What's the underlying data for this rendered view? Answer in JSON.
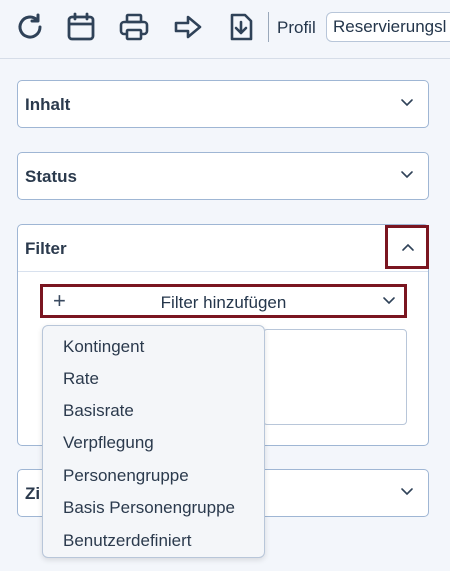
{
  "toolbar": {
    "icons": [
      "refresh-icon",
      "calendar-icon",
      "print-icon",
      "forward-arrow-icon",
      "download-file-icon"
    ],
    "profil_label": "Profil",
    "profil_value": "Reservierungsl"
  },
  "sections": {
    "inhalt": {
      "title": "Inhalt"
    },
    "status": {
      "title": "Status"
    },
    "filter": {
      "title": "Filter",
      "add_label": "Filter hinzufügen",
      "plus": "+"
    },
    "zi": {
      "title": "Zi"
    }
  },
  "dropdown": {
    "options": [
      "Kontingent",
      "Rate",
      "Basisrate",
      "Verpflegung",
      "Personengruppe",
      "Basis Personengruppe",
      "Benutzerdefiniert"
    ]
  },
  "colors": {
    "highlight": "#7a1520",
    "border": "#9fb6d4",
    "icon": "#2f4258"
  }
}
